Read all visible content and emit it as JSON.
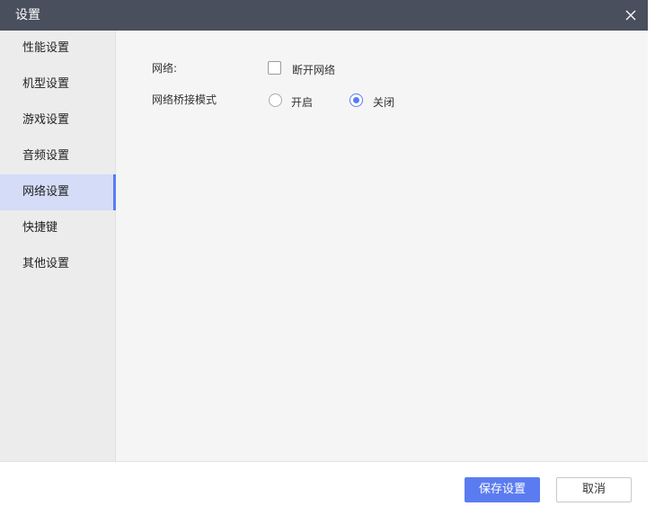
{
  "window": {
    "title": "设置",
    "close_icon": "close-icon"
  },
  "sidebar": {
    "items": [
      {
        "label": "性能设置",
        "active": false
      },
      {
        "label": "机型设置",
        "active": false
      },
      {
        "label": "游戏设置",
        "active": false
      },
      {
        "label": "音频设置",
        "active": false
      },
      {
        "label": "网络设置",
        "active": true
      },
      {
        "label": "快捷键",
        "active": false
      },
      {
        "label": "其他设置",
        "active": false
      }
    ]
  },
  "network": {
    "network_label": "网络:",
    "disconnect_label": "断开网络",
    "disconnect_checked": false,
    "bridge_label": "网络桥接模式",
    "bridge_on_label": "开启",
    "bridge_off_label": "关闭",
    "bridge_selected": "关闭"
  },
  "footer": {
    "save_label": "保存设置",
    "cancel_label": "取消"
  },
  "colors": {
    "titlebar": "#4a4f5d",
    "accent": "#5b7cf0",
    "active_nav": "#d4dcf7"
  }
}
